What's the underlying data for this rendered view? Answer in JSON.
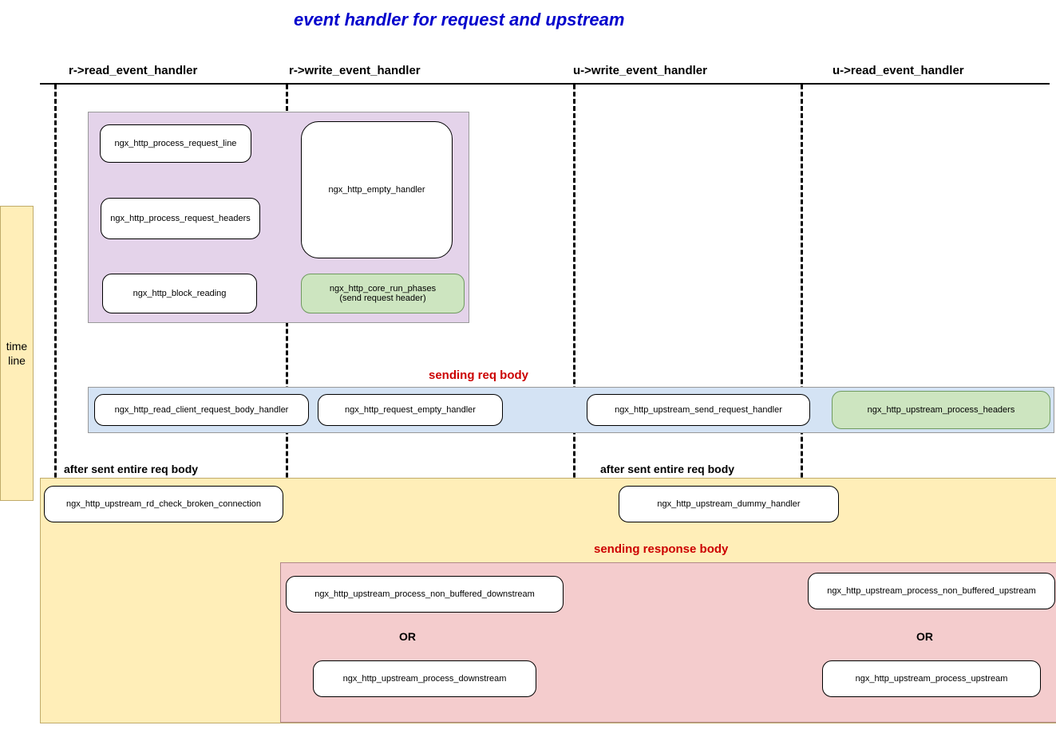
{
  "title": "event handler for request and upstream",
  "columns": {
    "c1": "r->read_event_handler",
    "c2": "r->write_event_handler",
    "c3": "u->write_event_handler",
    "c4": "u->read_event_handler"
  },
  "timeline": "time\nline",
  "phase1": {
    "box1": "ngx_http_process_request_line",
    "box2": "ngx_http_process_request_headers",
    "box3": "ngx_http_block_reading",
    "box4": "ngx_http_empty_handler",
    "box5a": "ngx_http_core_run_phases",
    "box5b": "(send request header)"
  },
  "phase2": {
    "title": "sending req body",
    "box1": "ngx_http_read_client_request_body_handler",
    "box2": "ngx_http_request_empty_handler",
    "box3": "ngx_http_upstream_send_request_handler",
    "box4": "ngx_http_upstream_process_headers"
  },
  "phase3": {
    "label1": "after sent entire req body",
    "label2": "after sent entire req body",
    "box1": "ngx_http_upstream_rd_check_broken_connection",
    "box2": "ngx_http_upstream_dummy_handler"
  },
  "phase4": {
    "title": "sending response body",
    "box1": "ngx_http_upstream_process_non_buffered_downstream",
    "or1": "OR",
    "box2": "ngx_http_upstream_process_downstream",
    "box3": "ngx_http_upstream_process_non_buffered_upstream",
    "or2": "OR",
    "box4": "ngx_http_upstream_process_upstream"
  }
}
